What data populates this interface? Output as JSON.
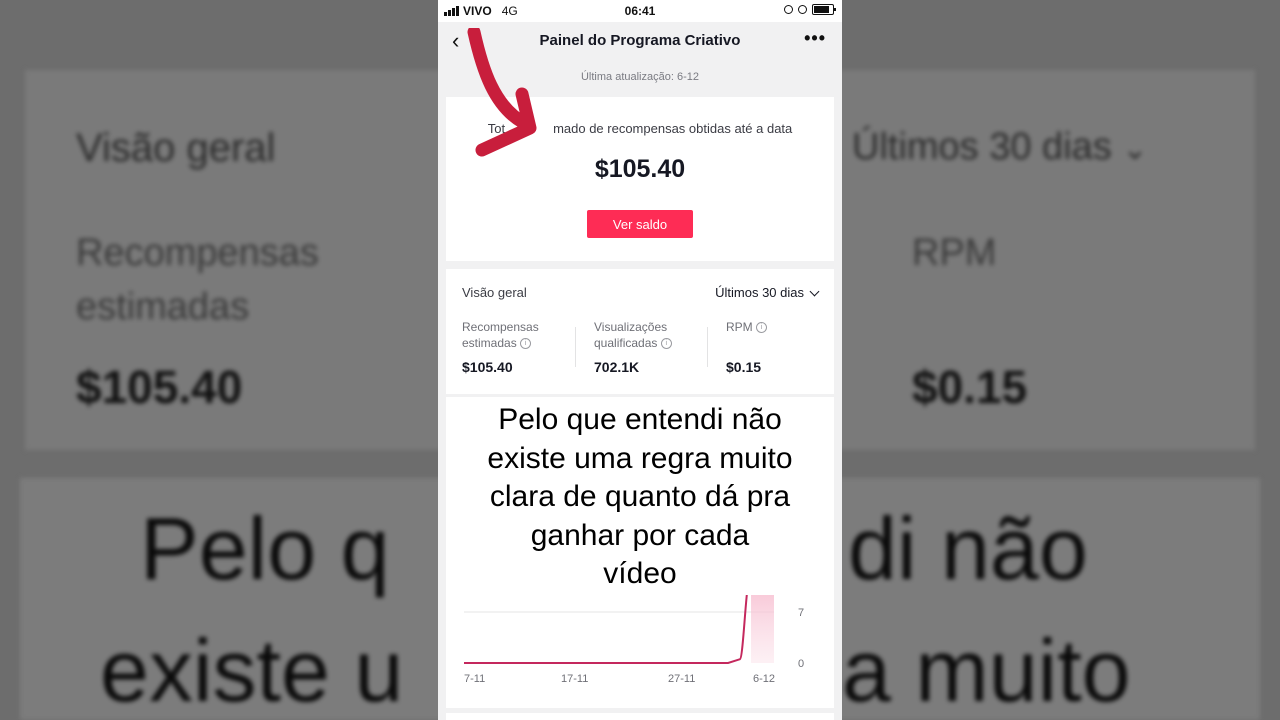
{
  "status_bar": {
    "carrier": "VIVO",
    "network": "4G",
    "time": "06:41"
  },
  "header": {
    "title": "Painel do Programa Criativo",
    "back_icon": "chevron-left-icon",
    "more_icon": "more-horizontal-icon"
  },
  "last_update": "Última atualização: 6-12",
  "rewards_card": {
    "label_left": "Tot",
    "label_right": "mado de recompensas obtidas até a data",
    "amount": "$105.40",
    "button_label": "Ver saldo",
    "button_color": "#fe2c55"
  },
  "overview": {
    "title": "Visão geral",
    "period": "Últimos 30 dias",
    "metrics": [
      {
        "label": "Recompensas estimadas",
        "value": "$105.40"
      },
      {
        "label": "Visualizações qualificadas",
        "value": "702.1K"
      },
      {
        "label": "RPM",
        "value": "$0.15"
      }
    ]
  },
  "caption": {
    "lines": [
      "Pelo que entendi não",
      "existe uma regra muito",
      "clara de quanto dá pra",
      "ganhar por cada",
      "vídeo"
    ]
  },
  "chart_data": {
    "type": "area",
    "x": [
      "7-11",
      "17-11",
      "27-11",
      "6-12"
    ],
    "y_ticks": [
      "7",
      "0"
    ],
    "ylim": [
      0,
      14
    ],
    "series": [
      {
        "points": [
          0,
          0,
          0,
          0,
          0,
          0,
          0,
          0,
          0,
          0,
          0,
          0,
          0,
          0,
          0,
          0,
          0,
          0,
          0,
          0,
          0,
          0,
          0,
          0,
          0.5,
          14,
          14,
          14
        ]
      }
    ],
    "line_color": "#c4285d"
  },
  "annotation": {
    "arrow_color": "#c81e3c"
  },
  "background": {
    "left_title": "Visão geral",
    "right_period": "Últimos 30 dias",
    "left_metric_line1": "Recompensas",
    "left_metric_line2": "estimadas",
    "left_value": "$105.40",
    "right_metric": "RPM",
    "right_value": "$0.15",
    "caption_line1_left": "Pelo q",
    "caption_line1_right": "di não",
    "caption_line2_left": "existe u",
    "caption_line2_right": "a muito"
  }
}
